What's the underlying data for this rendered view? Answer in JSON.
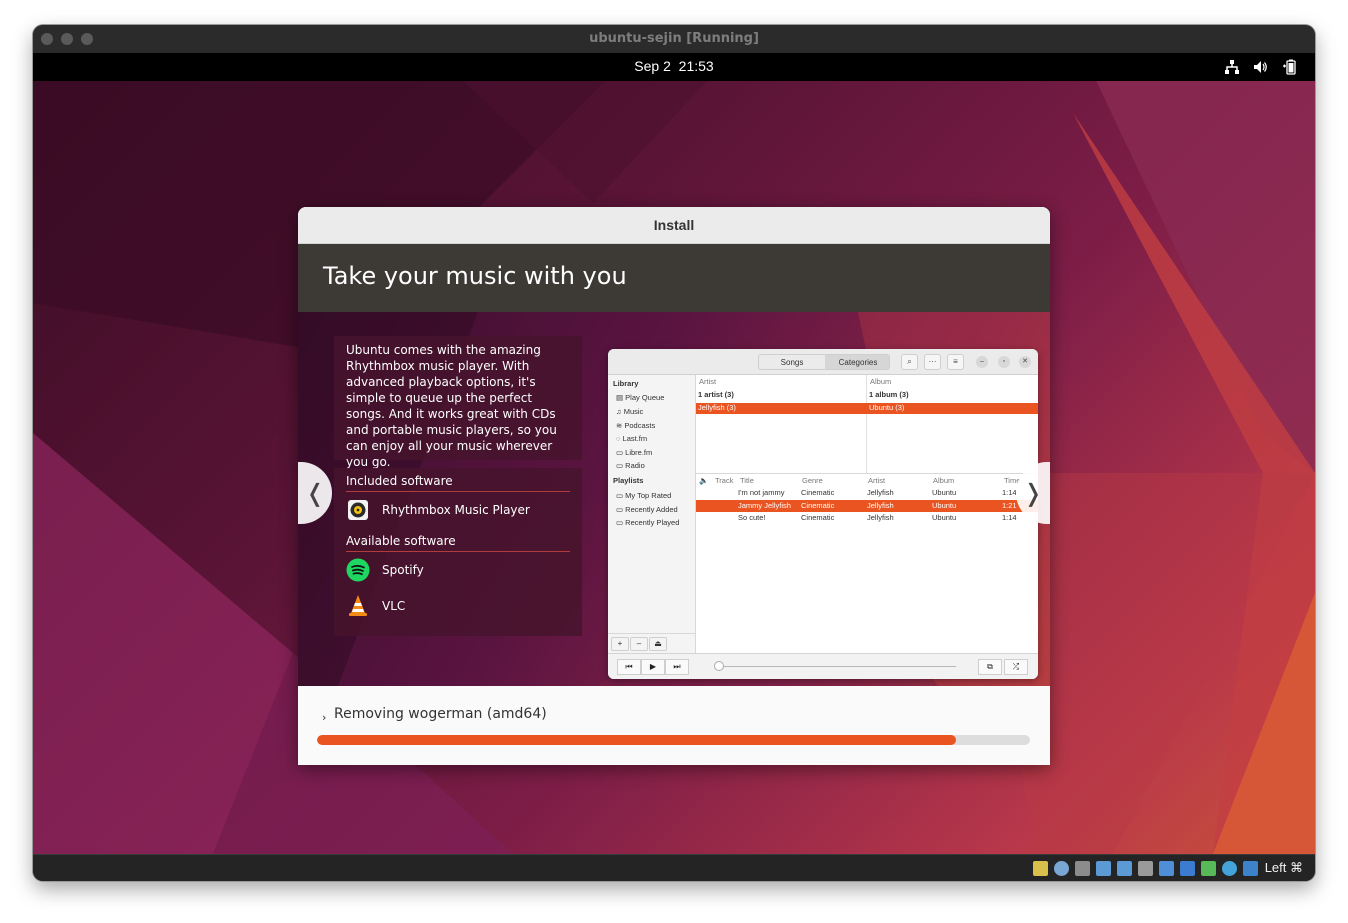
{
  "vm_window": {
    "title": "ubuntu-sejin [Running]"
  },
  "topbar": {
    "date": "Sep 2",
    "time": "21:53",
    "tray": [
      "network-icon",
      "volume-icon",
      "battery-icon"
    ]
  },
  "installer": {
    "title": "Install",
    "slide_title": "Take your music with you",
    "description": "Ubuntu comes with the amazing Rhythmbox music player. With advanced playback options, it's simple to queue up the perfect songs. And it works great with CDs and portable music players, so you can enjoy all your music wherever you go.",
    "included_heading": "Included software",
    "included": [
      {
        "name": "Rhythmbox Music Player",
        "icon": "rhythmbox-icon"
      }
    ],
    "available_heading": "Available software",
    "available": [
      {
        "name": "Spotify",
        "icon": "spotify-icon"
      },
      {
        "name": "VLC",
        "icon": "vlc-icon"
      }
    ],
    "prev_glyph": "❬",
    "next_glyph": "❭",
    "status": "Removing wogerman (amd64)",
    "expander_glyph": "›",
    "progress": 0.896,
    "accent": "#e95420"
  },
  "rhythmbox": {
    "tabs": [
      "Songs",
      "Categories"
    ],
    "toolbar_glyphs": [
      "⌕",
      "···",
      "≡"
    ],
    "window_glyphs": [
      "–",
      "▫",
      "✕"
    ],
    "library_heading": "Library",
    "library": [
      "Play Queue",
      "Music",
      "Podcasts",
      "Last.fm",
      "Libre.fm",
      "Radio"
    ],
    "playlists_heading": "Playlists",
    "playlists": [
      "My Top Rated",
      "Recently Added",
      "Recently Played"
    ],
    "browser": {
      "artist_header": "Artist",
      "album_header": "Album",
      "artist_all": "1 artist (3)",
      "album_all": "1 album (3)",
      "artist_sel": "Jellyfish (3)",
      "album_sel": "Ubuntu (3)"
    },
    "columns": [
      "🔈",
      "Track",
      "Title",
      "Genre",
      "Artist",
      "Album",
      "Time"
    ],
    "tracks": [
      {
        "title": "I'm not jammy",
        "genre": "Cinematic",
        "artist": "Jellyfish",
        "album": "Ubuntu",
        "time": "1:14"
      },
      {
        "title": "Jammy Jellyfish",
        "genre": "Cinematic",
        "artist": "Jellyfish",
        "album": "Ubuntu",
        "time": "1:21"
      },
      {
        "title": "So cute!",
        "genre": "Cinematic",
        "artist": "Jellyfish",
        "album": "Ubuntu",
        "time": "1:14"
      }
    ],
    "side_buttons": [
      "+",
      "–",
      "⏏"
    ],
    "transport": [
      "⏮",
      "▶",
      "⏭"
    ],
    "extra_buttons": [
      "⧉",
      "⤮"
    ]
  },
  "vm_status": {
    "host_key": "Left ⌘"
  }
}
